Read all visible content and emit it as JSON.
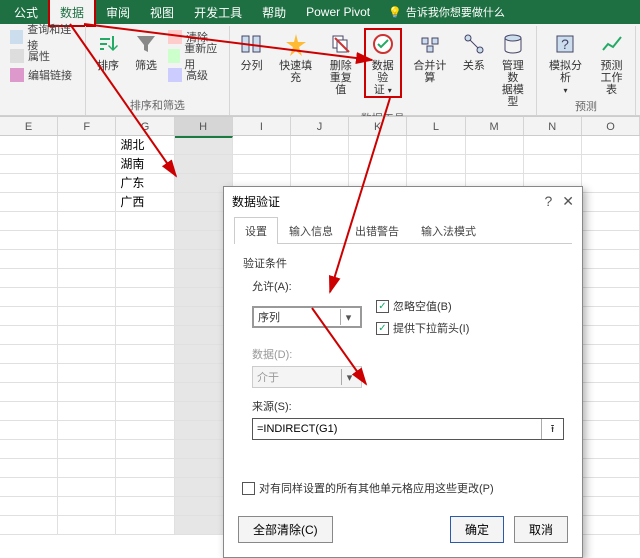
{
  "ribbon": {
    "tabs": [
      "公式",
      "数据",
      "审阅",
      "视图",
      "开发工具",
      "帮助",
      "Power Pivot"
    ],
    "active_tab": "数据",
    "tellme_icon": "lightbulb-icon",
    "tellme": "告诉我你想要做什么",
    "left_group": {
      "items": [
        "查询和连接",
        "属性",
        "编辑链接"
      ]
    },
    "sort_group": {
      "sort_btn": "排序",
      "filter_btn": "筛选",
      "clear": "清除",
      "reapply": "重新应用",
      "advanced": "高级",
      "label": "排序和筛选"
    },
    "data_tools_group": {
      "text_to_cols": "分列",
      "flash_fill": "快速填充",
      "remove_dup_l1": "删除",
      "remove_dup_l2": "重复值",
      "data_val_l1": "数据验",
      "data_val_l2": "证",
      "consolidate": "合并计算",
      "relationships": "关系",
      "manage_model_l1": "管理数",
      "manage_model_l2": "据模型",
      "label": "数据工具"
    },
    "forecast_group": {
      "whatif": "模拟分析",
      "forecast_l1": "预测",
      "forecast_l2": "工作表",
      "label": "预测"
    }
  },
  "columns": [
    "E",
    "F",
    "G",
    "H",
    "I",
    "J",
    "K",
    "L",
    "M",
    "N",
    "O"
  ],
  "selected_col": "H",
  "g_values": [
    "湖北",
    "湖南",
    "广东",
    "广西"
  ],
  "dialog": {
    "title": "数据验证",
    "tabs": [
      "设置",
      "输入信息",
      "出错警告",
      "输入法模式"
    ],
    "active_tab": "设置",
    "section": "验证条件",
    "allow_label": "允许(A):",
    "allow_value": "序列",
    "ignore_blank": "忽略空值(B)",
    "in_cell_dd": "提供下拉箭头(I)",
    "data_label": "数据(D):",
    "data_value": "介于",
    "source_label": "来源(S):",
    "source_value": "=INDIRECT(G1)",
    "apply_others": "对有同样设置的所有其他单元格应用这些更改(P)",
    "clear_all": "全部清除(C)",
    "ok": "确定",
    "cancel": "取消"
  }
}
